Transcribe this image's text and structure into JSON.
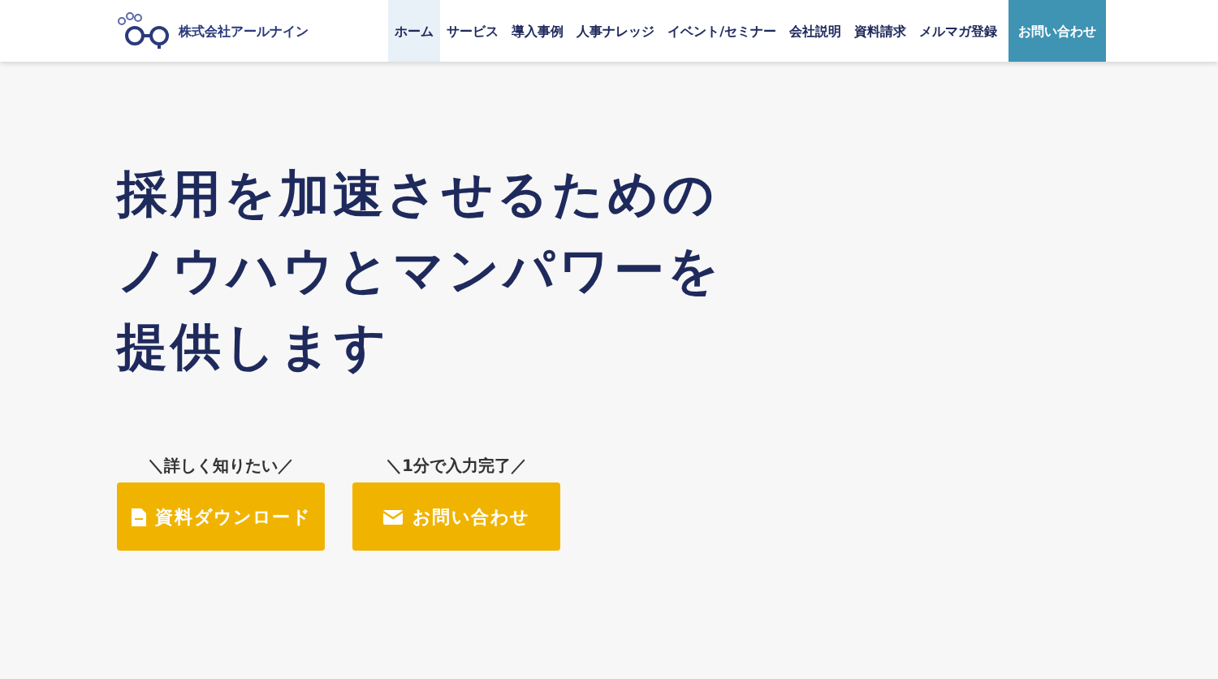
{
  "header": {
    "company": "株式会社アールナイン",
    "nav": [
      {
        "label": "ホーム",
        "kind": "link",
        "selected": true
      },
      {
        "label": "サービス",
        "kind": "link",
        "selected": false
      },
      {
        "label": "導入事例",
        "kind": "link",
        "selected": false
      },
      {
        "label": "人事ナレッジ",
        "kind": "link",
        "selected": false
      },
      {
        "label": "イベント/セミナー",
        "kind": "link",
        "selected": false
      },
      {
        "label": "会社説明",
        "kind": "link",
        "selected": false
      },
      {
        "label": "資料請求",
        "kind": "link",
        "selected": false
      },
      {
        "label": "メルマガ登録",
        "kind": "link",
        "selected": false
      },
      {
        "label": "お問い合わせ",
        "kind": "cta",
        "selected": false
      }
    ]
  },
  "hero": {
    "headline": [
      "採用を加速させるための",
      "ノウハウとマンパワーを",
      "提供します"
    ],
    "actions": [
      {
        "caption": "＼詳しく知りたい／",
        "label": "資料ダウンロード",
        "kind": "document"
      },
      {
        "caption": "＼1分で入力完了／",
        "label": "お問い合わせ",
        "kind": "mail"
      }
    ]
  }
}
